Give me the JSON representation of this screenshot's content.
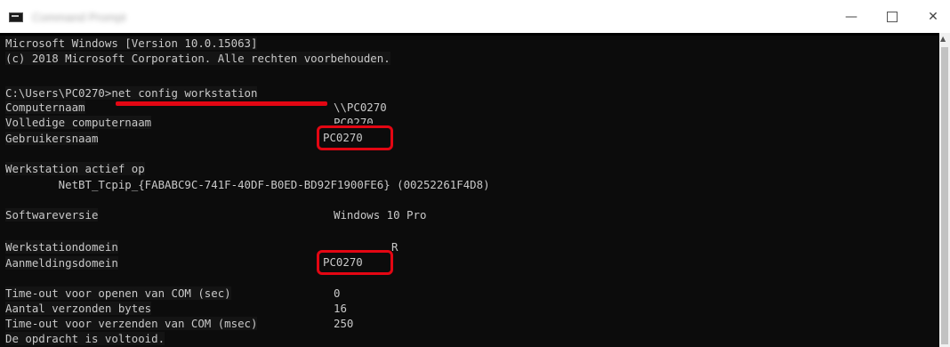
{
  "window": {
    "title": "Command Prompt",
    "controls": {
      "minimize": "—",
      "close": "✕"
    }
  },
  "console": {
    "lines": [
      "Microsoft Windows [Version 10.0.15063]",
      "(c) 2018 Microsoft Corporation. Alle rechten voorbehouden.",
      "C:\\Users\\PC0270>net config workstation",
      "Computernaam",
      "Volledige computernaam",
      "Gebruikersnaam",
      "Werkstation actief op",
      "        NetBT_Tcpip_{FABABC9C-741F-40DF-B0ED-BD92F1900FE6} (00252261F4D8)",
      "Softwareversie",
      "Werkstationdomein",
      "Aanmeldingsdomein",
      "Time-out voor openen van COM (sec)",
      "Aantal verzonden bytes",
      "Time-out voor verzenden van COM (msec)",
      "De opdracht is voltooid."
    ],
    "values": {
      "computernaam": "\\\\PC0270",
      "volledige_partial": "PC0270",
      "gebruikersnaam": "PC0270",
      "softwareversie": "Windows 10 Pro",
      "werkstationdomein_partial": "R",
      "aanmeldingsdomein": "PC0270",
      "com_open": "0",
      "bytes": "16",
      "com_send": "250"
    }
  },
  "colors": {
    "console_bg": "#0c0c0c",
    "console_text": "#c9c9c9",
    "annotation": "#e30613"
  }
}
